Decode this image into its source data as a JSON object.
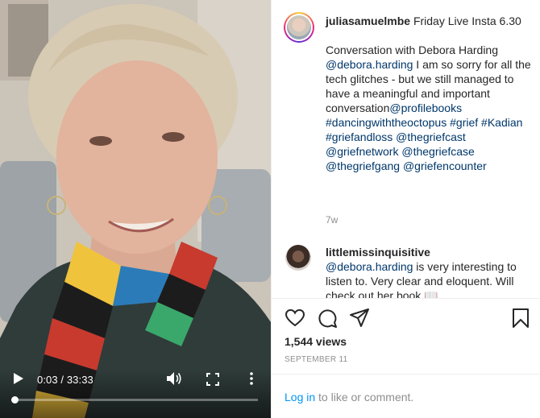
{
  "video": {
    "time_display": "0:03 / 33:33",
    "progress_fraction": 0.0015
  },
  "post": {
    "username": "juliasamuelmbe",
    "title": "Friday Live Insta 6.30",
    "caption_intro": "Conversation with Debora Harding",
    "caption_mention": "@debora.harding",
    "caption_body": " I am so sorry for all the tech glitches - but we still managed to have a meaningful and important conversation",
    "caption_mention2": "@profilebooks",
    "hashtags_line": [
      {
        "text": "#dancingwiththeoctopus",
        "sep": " "
      },
      {
        "text": "#grief",
        "sep": " "
      },
      {
        "text": "#Kadian",
        "sep": " "
      },
      {
        "text": "#griefandloss",
        "sep": " "
      },
      {
        "text": "@thegriefcast",
        "sep": " "
      },
      {
        "text": "@griefnetwork",
        "sep": " "
      },
      {
        "text": "@thegriefcase",
        "sep": " "
      },
      {
        "text": "@thegriefgang",
        "sep": " "
      },
      {
        "text": "@griefencounter",
        "sep": ""
      }
    ],
    "age": "7w"
  },
  "comment": {
    "username": "littlemissinquisitive",
    "mention": "@debora.harding",
    "text": " is very interesting to listen to. Very clear and eloquent. Will check out her book ",
    "emoji": "📖"
  },
  "actions": {
    "like_icon": "heart-icon",
    "comment_icon": "comment-bubble-icon",
    "share_icon": "paper-plane-icon",
    "save_icon": "bookmark-icon",
    "views": "1,544 views",
    "date": "SEPTEMBER 11",
    "login_link": "Log in",
    "login_suffix": " to like or comment."
  },
  "colors": {
    "link": "#00376b",
    "login_link": "#0095f6",
    "muted": "#8e8e8e",
    "text": "#262626"
  }
}
